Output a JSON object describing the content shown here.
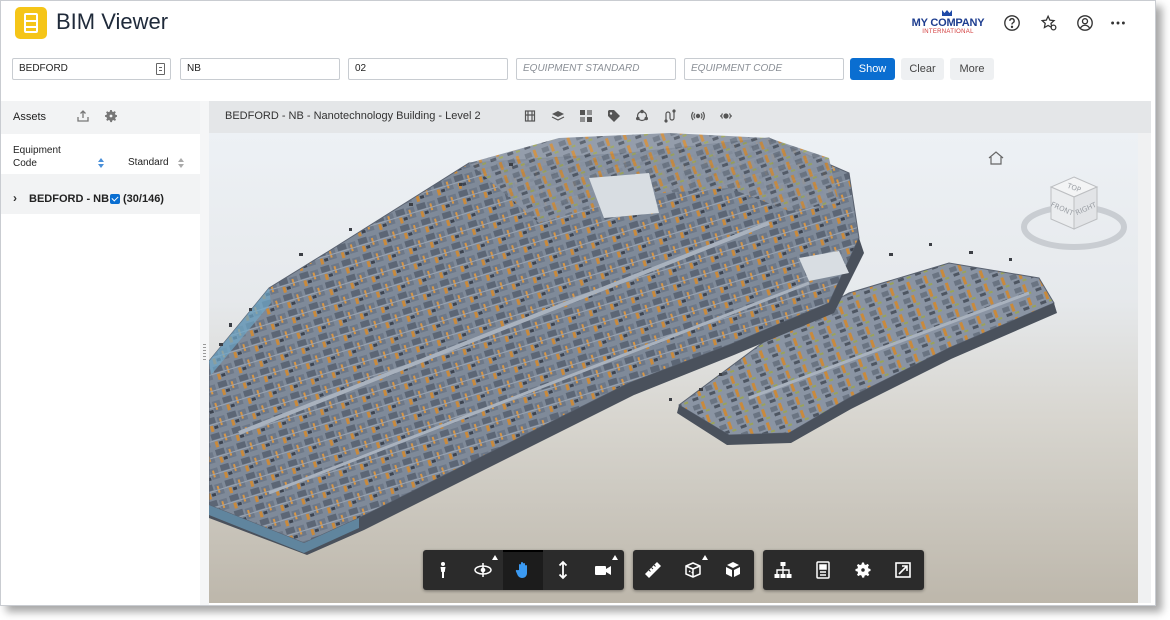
{
  "app": {
    "title": "BIM Viewer"
  },
  "company": {
    "name": "MY COMPANY",
    "subtitle": "INTERNATIONAL"
  },
  "header_icons": [
    "help-icon",
    "favorite-settings-icon",
    "user-account-icon",
    "more-icon"
  ],
  "filters": {
    "site": {
      "value": "BEDFORD"
    },
    "building": {
      "value": "NB"
    },
    "floor": {
      "value": "02"
    },
    "equipment_standard": {
      "value": "",
      "placeholder": "EQUIPMENT STANDARD"
    },
    "equipment_code": {
      "value": "",
      "placeholder": "EQUIPMENT CODE"
    },
    "show_label": "Show",
    "clear_label": "Clear",
    "more_label": "More"
  },
  "assets_panel": {
    "title": "Assets",
    "columns": {
      "code_line1": "Equipment",
      "code_line2": "Code",
      "standard": "Standard"
    },
    "tree": [
      {
        "label": "BEDFORD - NB",
        "checked": true,
        "count": "(30/146)"
      }
    ]
  },
  "viewer": {
    "title": "BEDFORD - NB - Nanotechnology Building - Level 2",
    "top_tools": [
      "floor-plan-icon",
      "layers-icon",
      "zones-icon",
      "tag-icon",
      "cycle-icon",
      "route-icon",
      "sensor-icon",
      "connected-icon"
    ],
    "nav_cube": {
      "top": "TOP",
      "front": "FRONT",
      "right": "RIGHT"
    },
    "toolbar_groups": [
      [
        "first-person-icon",
        "orbit-icon",
        "pan-icon",
        "zoom-icon",
        "camera-icon"
      ],
      [
        "measure-icon",
        "section-icon",
        "explode-icon"
      ],
      [
        "model-browser-icon",
        "properties-icon",
        "settings-icon",
        "fullscreen-icon"
      ]
    ],
    "active_tool": "pan-icon"
  },
  "colors": {
    "accent": "#0a6ed1",
    "logo": "#f5c518",
    "toolbar": "#2b2b2b"
  }
}
